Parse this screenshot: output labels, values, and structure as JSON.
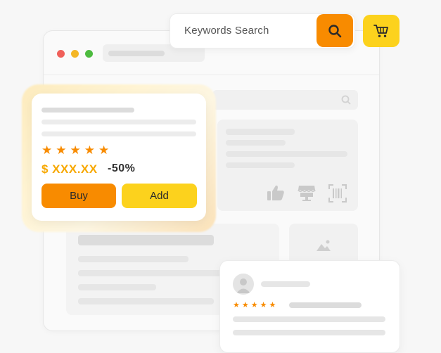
{
  "search": {
    "placeholder": "Keywords Search"
  },
  "product_card": {
    "rating": 5,
    "stars": [
      "★",
      "★",
      "★",
      "★",
      "★"
    ],
    "price": "$ XXX.XX",
    "discount": "-50%",
    "buy_label": "Buy",
    "add_label": "Add"
  },
  "review_card": {
    "rating": 5,
    "stars": [
      "★",
      "★",
      "★",
      "★",
      "★"
    ]
  },
  "colors": {
    "accent_orange": "#f88b00",
    "accent_yellow": "#fcd21d",
    "price_color": "#f7a800",
    "traffic_red": "#f0605a",
    "traffic_yellow": "#f4b625",
    "traffic_green": "#4dbb3f"
  },
  "icons": {
    "search": "search-icon",
    "cart": "cart-icon",
    "thumbs_up": "thumbs-up-icon",
    "store": "store-icon",
    "barcode": "barcode-icon",
    "image": "image-placeholder-icon",
    "avatar": "avatar-icon"
  }
}
